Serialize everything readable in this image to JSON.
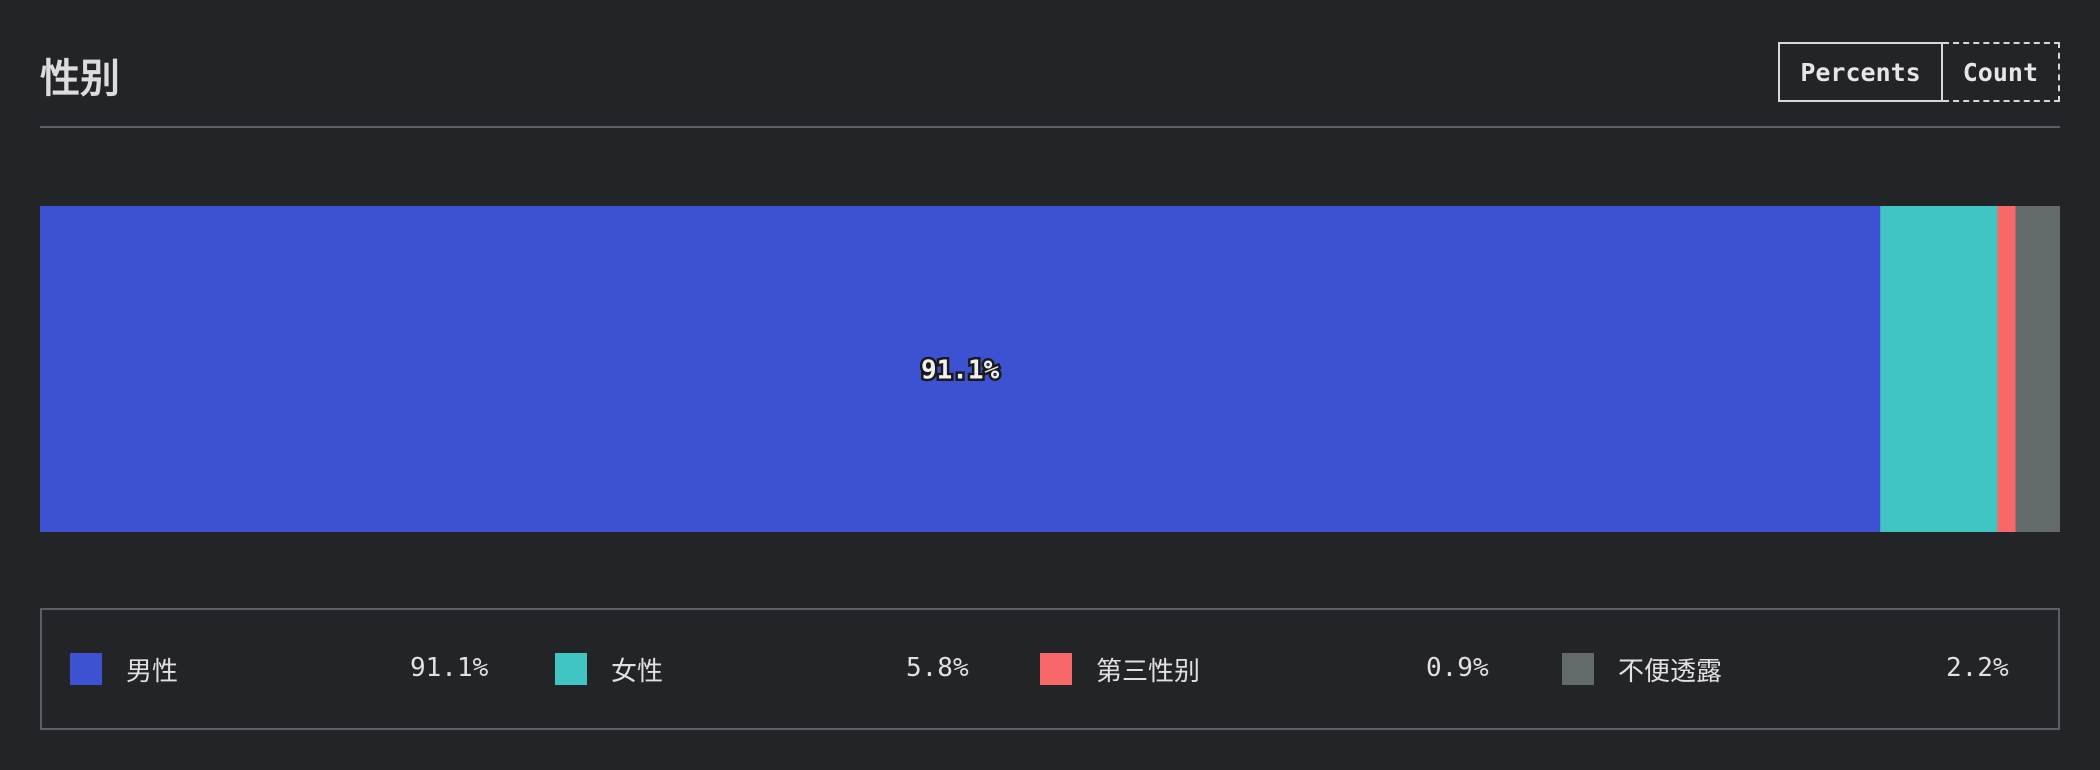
{
  "header": {
    "title": "性别",
    "toggle": {
      "percents_label": "Percents",
      "count_label": "Count"
    }
  },
  "chart_data": {
    "type": "bar",
    "orientation": "horizontal-stacked",
    "categories": [
      "男性",
      "女性",
      "第三性别",
      "不便透露"
    ],
    "values": [
      91.1,
      5.8,
      0.9,
      2.2
    ],
    "value_labels": [
      "91.1%",
      "5.8%",
      "0.9%",
      "2.2%"
    ],
    "colors": [
      "#3c52d3",
      "#40c4c4",
      "#f86868",
      "#636a6a"
    ],
    "unit": "%",
    "shown_bar_label_index": 0
  },
  "legend": {
    "items": [
      {
        "label": "男性",
        "value": "91.1%",
        "color": "#3c52d3"
      },
      {
        "label": "女性",
        "value": "5.8%",
        "color": "#40c4c4"
      },
      {
        "label": "第三性别",
        "value": "0.9%",
        "color": "#f86868"
      },
      {
        "label": "不便透露",
        "value": "2.2%",
        "color": "#636a6a"
      }
    ]
  }
}
